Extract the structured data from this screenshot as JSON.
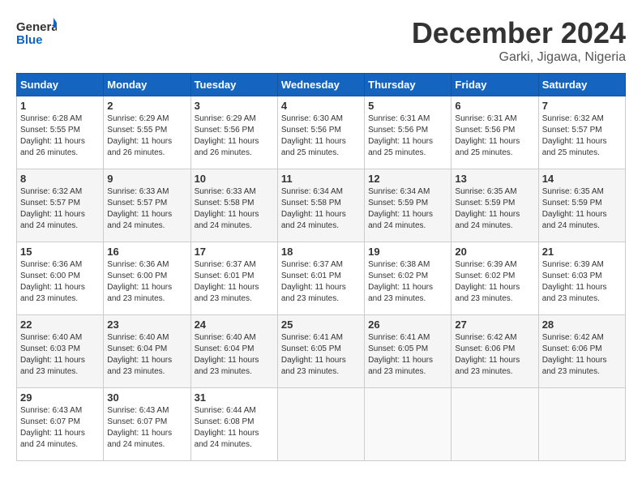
{
  "header": {
    "logo_line1": "General",
    "logo_line2": "Blue",
    "month_title": "December 2024",
    "location": "Garki, Jigawa, Nigeria"
  },
  "days_of_week": [
    "Sunday",
    "Monday",
    "Tuesday",
    "Wednesday",
    "Thursday",
    "Friday",
    "Saturday"
  ],
  "weeks": [
    [
      {
        "day": "1",
        "info": "Sunrise: 6:28 AM\nSunset: 5:55 PM\nDaylight: 11 hours\nand 26 minutes."
      },
      {
        "day": "2",
        "info": "Sunrise: 6:29 AM\nSunset: 5:55 PM\nDaylight: 11 hours\nand 26 minutes."
      },
      {
        "day": "3",
        "info": "Sunrise: 6:29 AM\nSunset: 5:56 PM\nDaylight: 11 hours\nand 26 minutes."
      },
      {
        "day": "4",
        "info": "Sunrise: 6:30 AM\nSunset: 5:56 PM\nDaylight: 11 hours\nand 25 minutes."
      },
      {
        "day": "5",
        "info": "Sunrise: 6:31 AM\nSunset: 5:56 PM\nDaylight: 11 hours\nand 25 minutes."
      },
      {
        "day": "6",
        "info": "Sunrise: 6:31 AM\nSunset: 5:56 PM\nDaylight: 11 hours\nand 25 minutes."
      },
      {
        "day": "7",
        "info": "Sunrise: 6:32 AM\nSunset: 5:57 PM\nDaylight: 11 hours\nand 25 minutes."
      }
    ],
    [
      {
        "day": "8",
        "info": "Sunrise: 6:32 AM\nSunset: 5:57 PM\nDaylight: 11 hours\nand 24 minutes."
      },
      {
        "day": "9",
        "info": "Sunrise: 6:33 AM\nSunset: 5:57 PM\nDaylight: 11 hours\nand 24 minutes."
      },
      {
        "day": "10",
        "info": "Sunrise: 6:33 AM\nSunset: 5:58 PM\nDaylight: 11 hours\nand 24 minutes."
      },
      {
        "day": "11",
        "info": "Sunrise: 6:34 AM\nSunset: 5:58 PM\nDaylight: 11 hours\nand 24 minutes."
      },
      {
        "day": "12",
        "info": "Sunrise: 6:34 AM\nSunset: 5:59 PM\nDaylight: 11 hours\nand 24 minutes."
      },
      {
        "day": "13",
        "info": "Sunrise: 6:35 AM\nSunset: 5:59 PM\nDaylight: 11 hours\nand 24 minutes."
      },
      {
        "day": "14",
        "info": "Sunrise: 6:35 AM\nSunset: 5:59 PM\nDaylight: 11 hours\nand 24 minutes."
      }
    ],
    [
      {
        "day": "15",
        "info": "Sunrise: 6:36 AM\nSunset: 6:00 PM\nDaylight: 11 hours\nand 23 minutes."
      },
      {
        "day": "16",
        "info": "Sunrise: 6:36 AM\nSunset: 6:00 PM\nDaylight: 11 hours\nand 23 minutes."
      },
      {
        "day": "17",
        "info": "Sunrise: 6:37 AM\nSunset: 6:01 PM\nDaylight: 11 hours\nand 23 minutes."
      },
      {
        "day": "18",
        "info": "Sunrise: 6:37 AM\nSunset: 6:01 PM\nDaylight: 11 hours\nand 23 minutes."
      },
      {
        "day": "19",
        "info": "Sunrise: 6:38 AM\nSunset: 6:02 PM\nDaylight: 11 hours\nand 23 minutes."
      },
      {
        "day": "20",
        "info": "Sunrise: 6:39 AM\nSunset: 6:02 PM\nDaylight: 11 hours\nand 23 minutes."
      },
      {
        "day": "21",
        "info": "Sunrise: 6:39 AM\nSunset: 6:03 PM\nDaylight: 11 hours\nand 23 minutes."
      }
    ],
    [
      {
        "day": "22",
        "info": "Sunrise: 6:40 AM\nSunset: 6:03 PM\nDaylight: 11 hours\nand 23 minutes."
      },
      {
        "day": "23",
        "info": "Sunrise: 6:40 AM\nSunset: 6:04 PM\nDaylight: 11 hours\nand 23 minutes."
      },
      {
        "day": "24",
        "info": "Sunrise: 6:40 AM\nSunset: 6:04 PM\nDaylight: 11 hours\nand 23 minutes."
      },
      {
        "day": "25",
        "info": "Sunrise: 6:41 AM\nSunset: 6:05 PM\nDaylight: 11 hours\nand 23 minutes."
      },
      {
        "day": "26",
        "info": "Sunrise: 6:41 AM\nSunset: 6:05 PM\nDaylight: 11 hours\nand 23 minutes."
      },
      {
        "day": "27",
        "info": "Sunrise: 6:42 AM\nSunset: 6:06 PM\nDaylight: 11 hours\nand 23 minutes."
      },
      {
        "day": "28",
        "info": "Sunrise: 6:42 AM\nSunset: 6:06 PM\nDaylight: 11 hours\nand 23 minutes."
      }
    ],
    [
      {
        "day": "29",
        "info": "Sunrise: 6:43 AM\nSunset: 6:07 PM\nDaylight: 11 hours\nand 24 minutes."
      },
      {
        "day": "30",
        "info": "Sunrise: 6:43 AM\nSunset: 6:07 PM\nDaylight: 11 hours\nand 24 minutes."
      },
      {
        "day": "31",
        "info": "Sunrise: 6:44 AM\nSunset: 6:08 PM\nDaylight: 11 hours\nand 24 minutes."
      },
      {
        "day": "",
        "info": ""
      },
      {
        "day": "",
        "info": ""
      },
      {
        "day": "",
        "info": ""
      },
      {
        "day": "",
        "info": ""
      }
    ]
  ]
}
